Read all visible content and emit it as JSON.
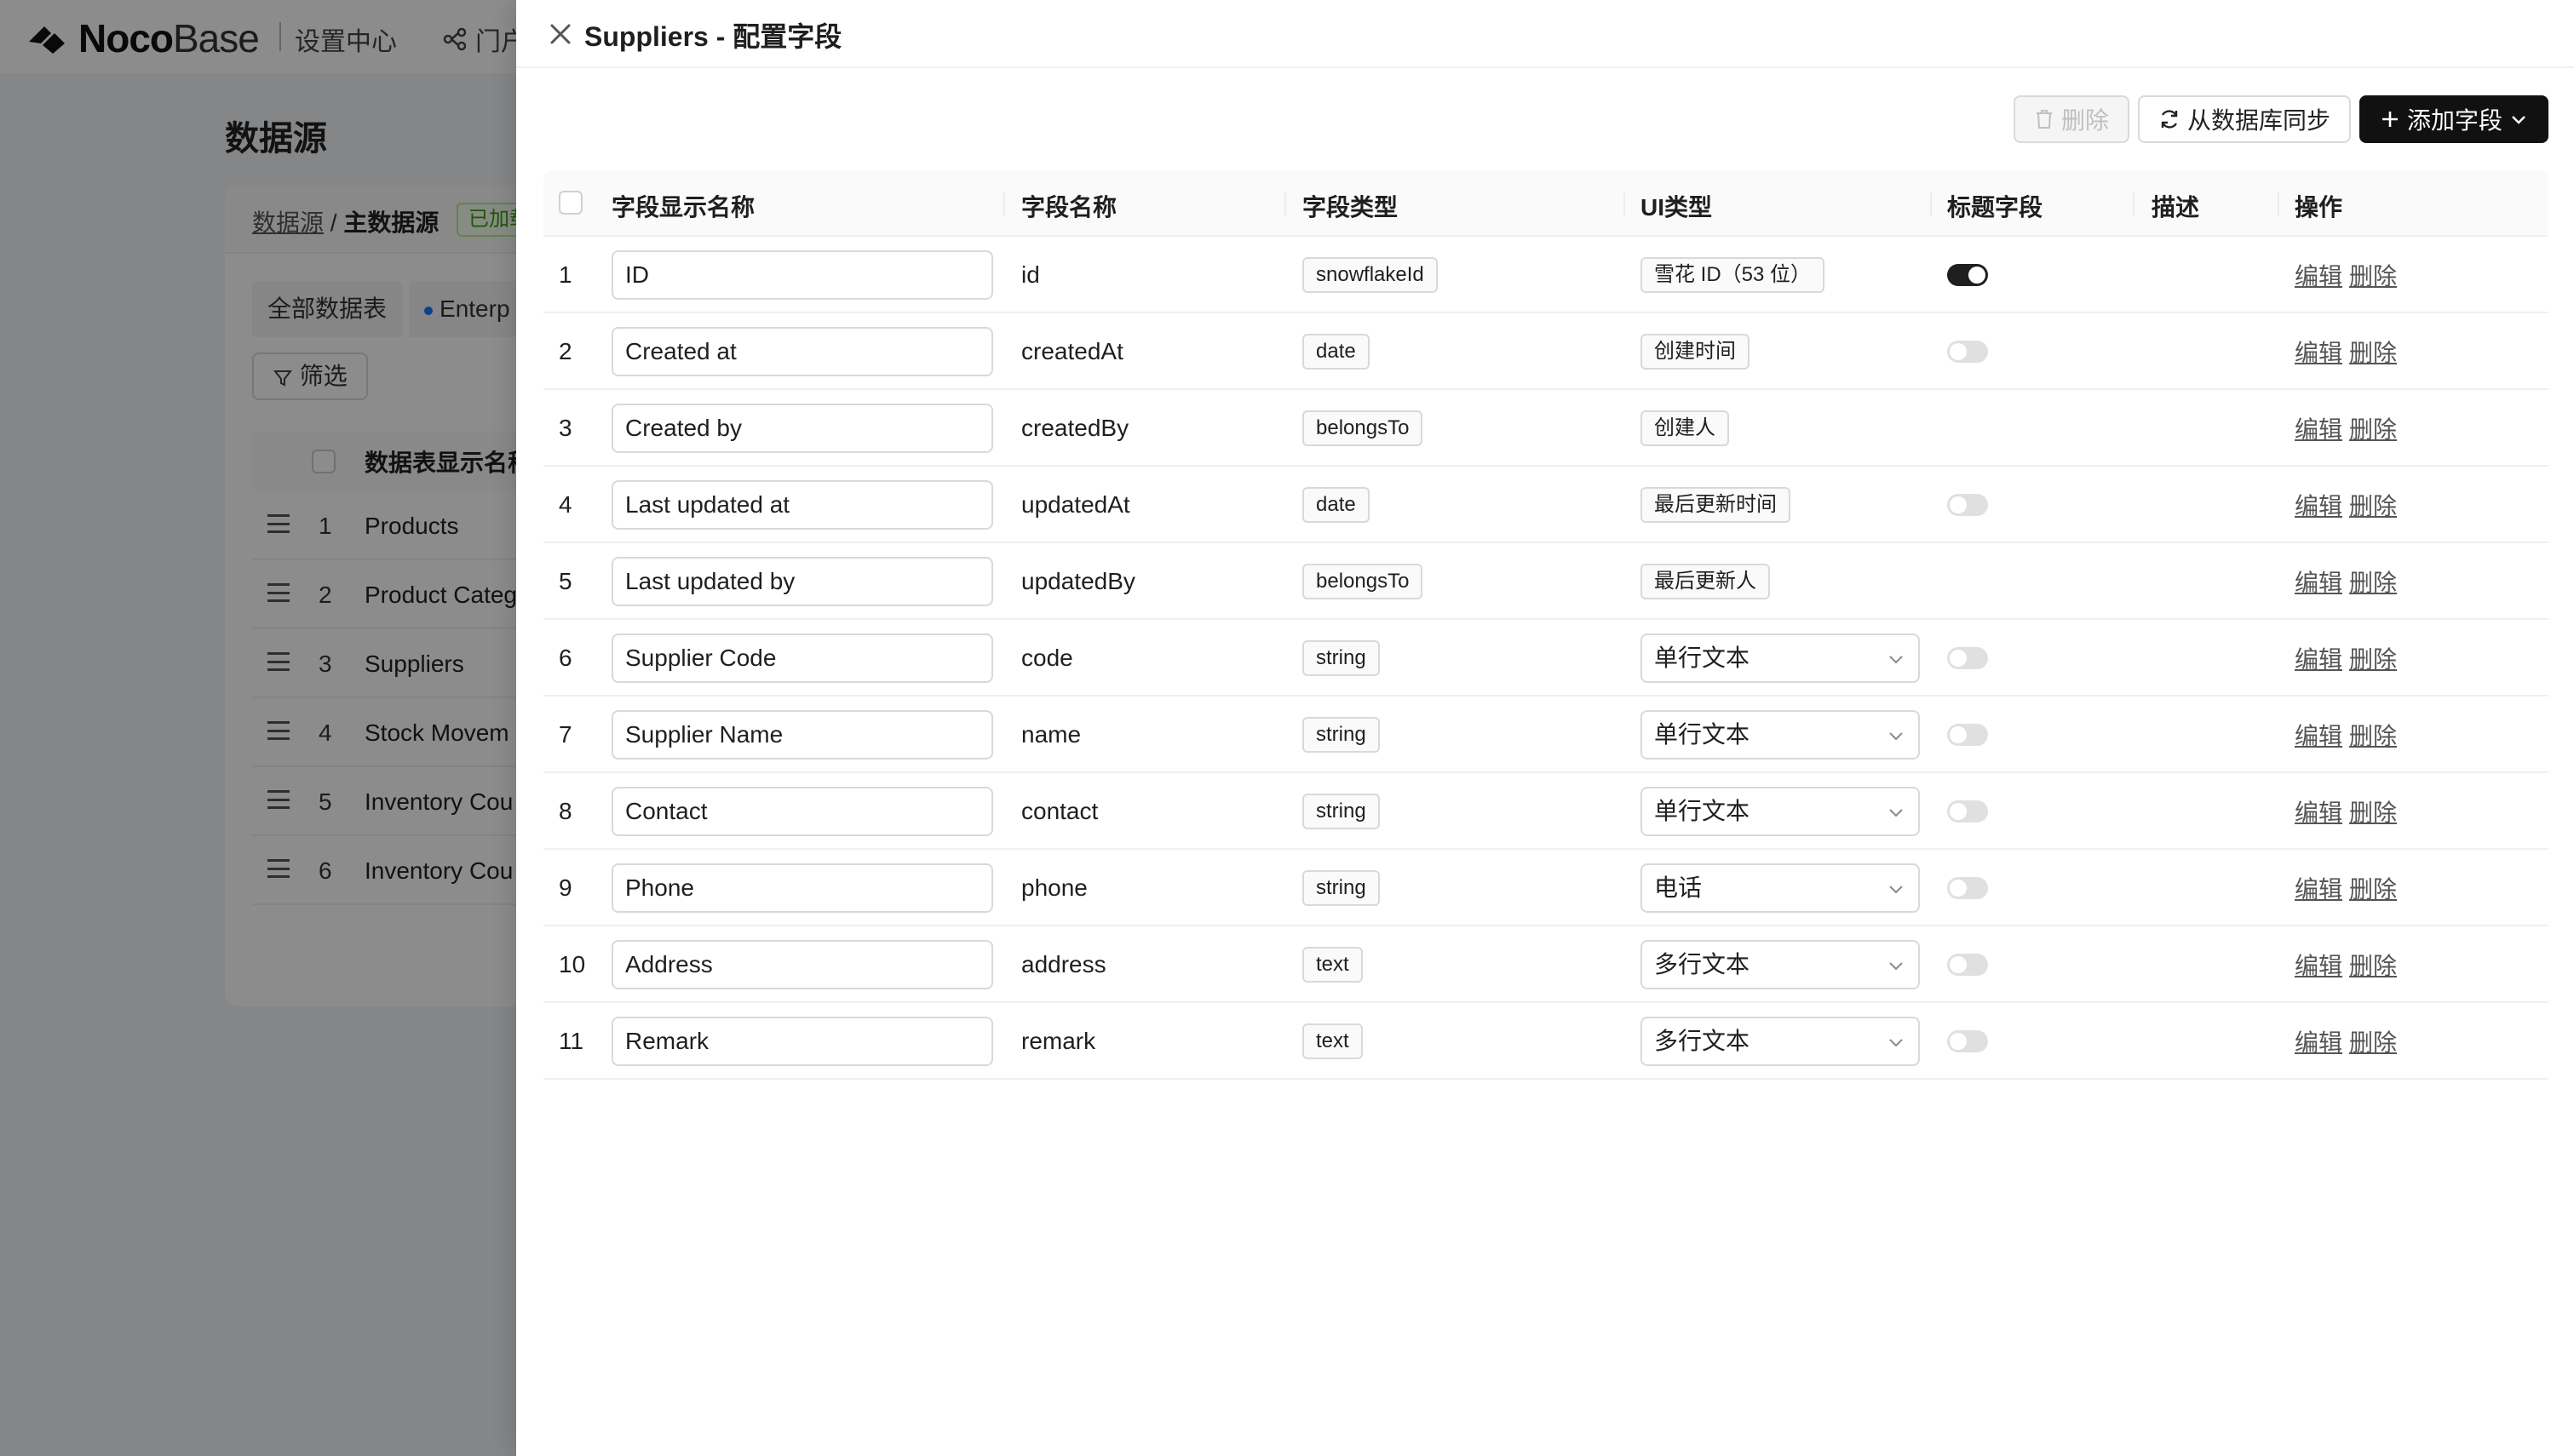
{
  "topbar": {
    "logo_bold": "Noco",
    "logo_light": "Base",
    "settings_label": "设置中心",
    "portal_label": "门户"
  },
  "background": {
    "title": "数据源",
    "breadcrumb": {
      "root": "数据源",
      "sep": "/",
      "current": "主数据源"
    },
    "status_tag": "已加载",
    "tabs": [
      "全部数据表",
      "Enterp"
    ],
    "filter_label": "筛选",
    "table_header": "数据表显示名称",
    "rows": [
      {
        "num": "1",
        "name": "Products"
      },
      {
        "num": "2",
        "name": "Product Categ"
      },
      {
        "num": "3",
        "name": "Suppliers"
      },
      {
        "num": "4",
        "name": "Stock Movem"
      },
      {
        "num": "5",
        "name": "Inventory Cou"
      },
      {
        "num": "6",
        "name": "Inventory Cou"
      }
    ]
  },
  "drawer": {
    "title": "Suppliers - 配置字段",
    "toolbar": {
      "delete_label": "删除",
      "sync_label": "从数据库同步",
      "add_label": "添加字段"
    },
    "columns": {
      "title": "字段显示名称",
      "name": "字段名称",
      "type": "字段类型",
      "ui": "UI类型",
      "title_field": "标题字段",
      "desc": "描述",
      "actions": "操作"
    },
    "action_edit": "编辑",
    "action_delete": "删除",
    "rows": [
      {
        "num": "1",
        "title": "ID",
        "name": "id",
        "type": "snowflakeId",
        "ui": "雪花 ID（53 位）",
        "ui_kind": "tag",
        "title_field": "on"
      },
      {
        "num": "2",
        "title": "Created at",
        "name": "createdAt",
        "type": "date",
        "ui": "创建时间",
        "ui_kind": "tag",
        "title_field": "off"
      },
      {
        "num": "3",
        "title": "Created by",
        "name": "createdBy",
        "type": "belongsTo",
        "ui": "创建人",
        "ui_kind": "tag",
        "title_field": "none"
      },
      {
        "num": "4",
        "title": "Last updated at",
        "name": "updatedAt",
        "type": "date",
        "ui": "最后更新时间",
        "ui_kind": "tag",
        "title_field": "off"
      },
      {
        "num": "5",
        "title": "Last updated by",
        "name": "updatedBy",
        "type": "belongsTo",
        "ui": "最后更新人",
        "ui_kind": "tag",
        "title_field": "none"
      },
      {
        "num": "6",
        "title": "Supplier Code",
        "name": "code",
        "type": "string",
        "ui": "单行文本",
        "ui_kind": "select",
        "title_field": "off"
      },
      {
        "num": "7",
        "title": "Supplier Name",
        "name": "name",
        "type": "string",
        "ui": "单行文本",
        "ui_kind": "select",
        "title_field": "off"
      },
      {
        "num": "8",
        "title": "Contact",
        "name": "contact",
        "type": "string",
        "ui": "单行文本",
        "ui_kind": "select",
        "title_field": "off"
      },
      {
        "num": "9",
        "title": "Phone",
        "name": "phone",
        "type": "string",
        "ui": "电话",
        "ui_kind": "select",
        "title_field": "off"
      },
      {
        "num": "10",
        "title": "Address",
        "name": "address",
        "type": "text",
        "ui": "多行文本",
        "ui_kind": "select",
        "title_field": "off"
      },
      {
        "num": "11",
        "title": "Remark",
        "name": "remark",
        "type": "text",
        "ui": "多行文本",
        "ui_kind": "select",
        "title_field": "off"
      }
    ]
  },
  "colors": {
    "primary": "#111111",
    "overlay": "#000000",
    "tag_success": "#389e0d"
  }
}
